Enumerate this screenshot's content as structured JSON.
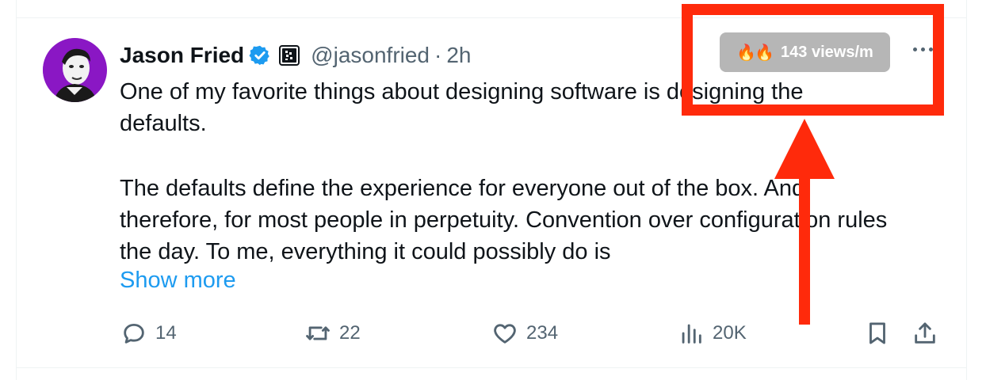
{
  "tweet": {
    "author_name": "Jason Fried",
    "handle": "@jasonfried",
    "separator": "·",
    "time": "2h",
    "text_line_1": "One of my favorite things about designing software is designing the",
    "text_line_2": "defaults.",
    "text_para_2": "The defaults define the experience for everyone out of the box. And, therefore, for most people in perpetuity. Convention over configuration rules the day. To me, everything it could possibly do is",
    "show_more": "Show more"
  },
  "overlay": {
    "views_rate": "143 views/m",
    "fire_icons": "🔥🔥"
  },
  "actions": {
    "replies": "14",
    "reposts": "22",
    "likes": "234",
    "views": "20K"
  },
  "colors": {
    "accent_link": "#1d9bf0",
    "avatar_bg": "#8a17c4",
    "annotation": "#ff2a0b",
    "badge_bg": "#b6b6b6",
    "muted": "#536471"
  },
  "icons": [
    "verified-badge-icon",
    "affiliate-logo-icon",
    "more-options-icon",
    "reply-icon",
    "repost-icon",
    "like-icon",
    "views-icon",
    "bookmark-icon",
    "share-icon",
    "fire-icon"
  ]
}
